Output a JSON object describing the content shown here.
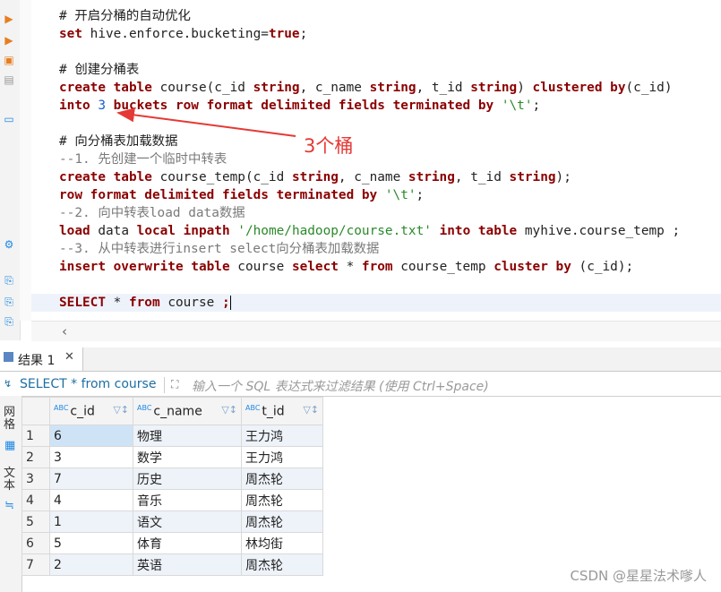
{
  "editor": {
    "lines": [
      [
        {
          "t": "# 开启分桶的自动优化",
          "c": "cmh"
        }
      ],
      [
        {
          "t": "set ",
          "c": "kw"
        },
        {
          "t": "hive.enforce.bucketing=",
          "c": ""
        },
        {
          "t": "true",
          "c": "kw"
        },
        {
          "t": ";",
          "c": ""
        }
      ],
      [],
      [
        {
          "t": "# 创建分桶表",
          "c": "cmh"
        }
      ],
      [
        {
          "t": "create table ",
          "c": "kw"
        },
        {
          "t": "course(c_id ",
          "c": ""
        },
        {
          "t": "string",
          "c": "kw"
        },
        {
          "t": ", c_name ",
          "c": ""
        },
        {
          "t": "string",
          "c": "kw"
        },
        {
          "t": ", t_id ",
          "c": ""
        },
        {
          "t": "string",
          "c": "kw"
        },
        {
          "t": ") ",
          "c": ""
        },
        {
          "t": "clustered by",
          "c": "kw"
        },
        {
          "t": "(c_id)",
          "c": ""
        }
      ],
      [
        {
          "t": "into ",
          "c": "kw"
        },
        {
          "t": "3",
          "c": "num"
        },
        {
          "t": " buckets row format delimited fields terminated by ",
          "c": "kw"
        },
        {
          "t": "'\\t'",
          "c": "str"
        },
        {
          "t": ";",
          "c": ""
        }
      ],
      [],
      [
        {
          "t": "# 向分桶表加载数据",
          "c": "cmh"
        }
      ],
      [
        {
          "t": "--1. 先创建一个临时中转表",
          "c": "cm"
        }
      ],
      [
        {
          "t": "create table ",
          "c": "kw"
        },
        {
          "t": "course_temp(c_id ",
          "c": ""
        },
        {
          "t": "string",
          "c": "kw"
        },
        {
          "t": ", c_name ",
          "c": ""
        },
        {
          "t": "string",
          "c": "kw"
        },
        {
          "t": ", t_id ",
          "c": ""
        },
        {
          "t": "string",
          "c": "kw"
        },
        {
          "t": ");",
          "c": ""
        }
      ],
      [
        {
          "t": "row format delimited fields terminated by ",
          "c": "kw"
        },
        {
          "t": "'\\t'",
          "c": "str"
        },
        {
          "t": ";",
          "c": ""
        }
      ],
      [
        {
          "t": "--2. 向中转表load data数据",
          "c": "cm"
        }
      ],
      [
        {
          "t": "load ",
          "c": "kw"
        },
        {
          "t": "data ",
          "c": ""
        },
        {
          "t": "local inpath ",
          "c": "kw"
        },
        {
          "t": "'/home/hadoop/course.txt'",
          "c": "str"
        },
        {
          "t": " ",
          "c": ""
        },
        {
          "t": "into table ",
          "c": "kw"
        },
        {
          "t": "myhive.course_temp ;",
          "c": ""
        }
      ],
      [
        {
          "t": "--3. 从中转表进行insert select向分桶表加载数据",
          "c": "cm"
        }
      ],
      [
        {
          "t": "insert overwrite table ",
          "c": "kw"
        },
        {
          "t": "course ",
          "c": ""
        },
        {
          "t": "select ",
          "c": "kw"
        },
        {
          "t": "* ",
          "c": ""
        },
        {
          "t": "from ",
          "c": "kw"
        },
        {
          "t": "course_temp ",
          "c": ""
        },
        {
          "t": "cluster by ",
          "c": "kw"
        },
        {
          "t": "(c_id);",
          "c": ""
        }
      ],
      [],
      [
        {
          "t": "SELECT ",
          "c": "kw"
        },
        {
          "t": "* ",
          "c": ""
        },
        {
          "t": "from ",
          "c": "kw"
        },
        {
          "t": "course ",
          "c": ""
        },
        {
          "t": ";",
          "c": "kw"
        }
      ]
    ]
  },
  "annotation": {
    "text": "3个桶",
    "color": "#e53935"
  },
  "results": {
    "tab_label": "结果 1",
    "query_label": "SELECT * from course",
    "filter_placeholder": "输入一个 SQL 表达式来过滤结果 (使用 Ctrl+Space)",
    "side_labels": {
      "grid": "网格",
      "text": "文本"
    },
    "columns": [
      "c_id",
      "c_name",
      "t_id"
    ],
    "rows": [
      [
        "1",
        "6",
        "物理",
        "王力鸿"
      ],
      [
        "2",
        "3",
        "数学",
        "王力鸿"
      ],
      [
        "3",
        "7",
        "历史",
        "周杰轮"
      ],
      [
        "4",
        "4",
        "音乐",
        "周杰轮"
      ],
      [
        "5",
        "1",
        "语文",
        "周杰轮"
      ],
      [
        "6",
        "5",
        "体育",
        "林均街"
      ],
      [
        "7",
        "2",
        "英语",
        "周杰轮"
      ]
    ]
  },
  "watermark": "CSDN @星星法术嗲人",
  "colors": {
    "keyword": "#8b0000",
    "string": "#2a8a2a",
    "comment": "#7a7a7a",
    "accent": "#1c6ea4"
  }
}
